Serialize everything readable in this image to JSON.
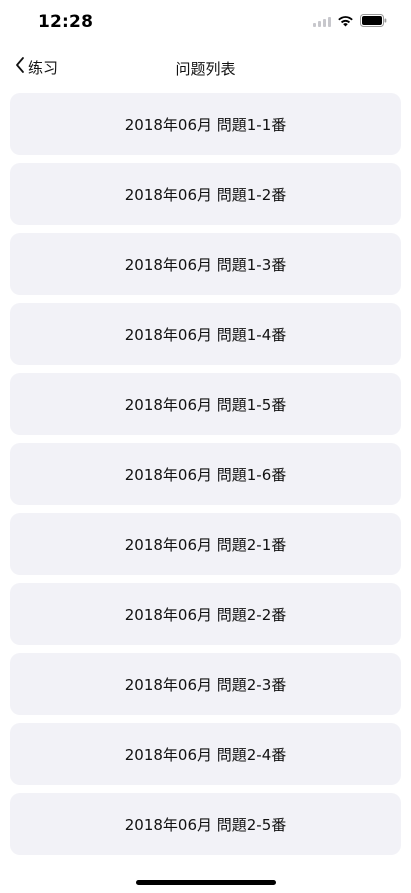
{
  "status_bar": {
    "time": "12:28",
    "icons": [
      "signal-icon",
      "wifi-icon",
      "battery-icon"
    ]
  },
  "nav": {
    "back_label": "练习",
    "title": "问题列表",
    "back_icon": "chevron-left-icon"
  },
  "list": {
    "items": [
      {
        "label": "2018年06月 問題1-1番"
      },
      {
        "label": "2018年06月 問題1-2番"
      },
      {
        "label": "2018年06月 問題1-3番"
      },
      {
        "label": "2018年06月 問題1-4番"
      },
      {
        "label": "2018年06月 問題1-5番"
      },
      {
        "label": "2018年06月 問題1-6番"
      },
      {
        "label": "2018年06月 問題2-1番"
      },
      {
        "label": "2018年06月 問題2-2番"
      },
      {
        "label": "2018年06月 問題2-3番"
      },
      {
        "label": "2018年06月 問題2-4番"
      },
      {
        "label": "2018年06月 問題2-5番"
      }
    ]
  },
  "colors": {
    "card_background": "#f2f2f7",
    "text": "#111111",
    "background": "#ffffff"
  }
}
